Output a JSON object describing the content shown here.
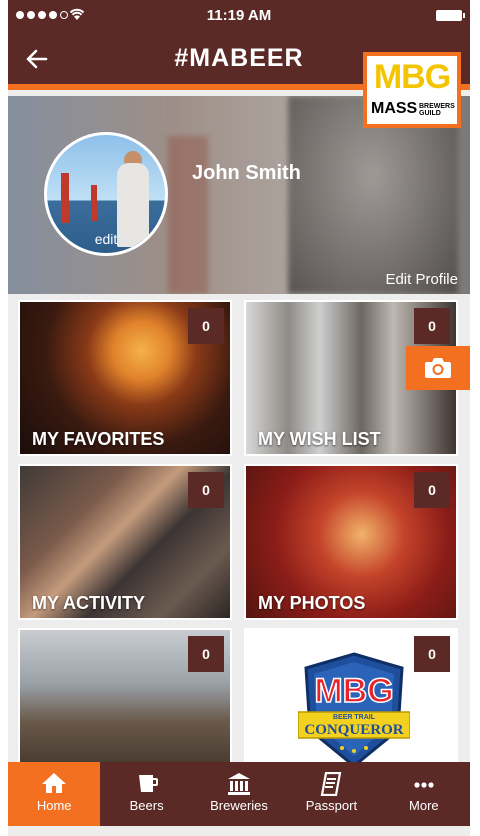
{
  "status_bar": {
    "time": "11:19 AM"
  },
  "nav": {
    "title": "#MABEER"
  },
  "logo": {
    "mbg": "MBG",
    "mass": "MASS",
    "brewers_guild": "BREWERS GUILD"
  },
  "profile": {
    "name": "John Smith",
    "avatar_edit": "edit",
    "edit_profile": "Edit Profile"
  },
  "tiles": [
    {
      "label": "MY FAVORITES",
      "count": "0"
    },
    {
      "label": "MY WISH LIST",
      "count": "0"
    },
    {
      "label": "MY ACTIVITY",
      "count": "0"
    },
    {
      "label": "MY PHOTOS",
      "count": "0"
    },
    {
      "label": "",
      "count": "0"
    },
    {
      "label": "",
      "count": "0"
    }
  ],
  "badge": {
    "mbg": "MBG",
    "ribbon_top": "BEER TRAIL",
    "ribbon_main": "CONQUEROR"
  },
  "tabbar": [
    {
      "label": "Home",
      "icon": "home-icon",
      "active": true
    },
    {
      "label": "Beers",
      "icon": "beer-icon",
      "active": false
    },
    {
      "label": "Breweries",
      "icon": "brewery-icon",
      "active": false
    },
    {
      "label": "Passport",
      "icon": "passport-icon",
      "active": false
    },
    {
      "label": "More",
      "icon": "more-icon",
      "active": false
    }
  ],
  "colors": {
    "brand_brown": "#5b2a26",
    "accent_orange": "#f37021"
  }
}
